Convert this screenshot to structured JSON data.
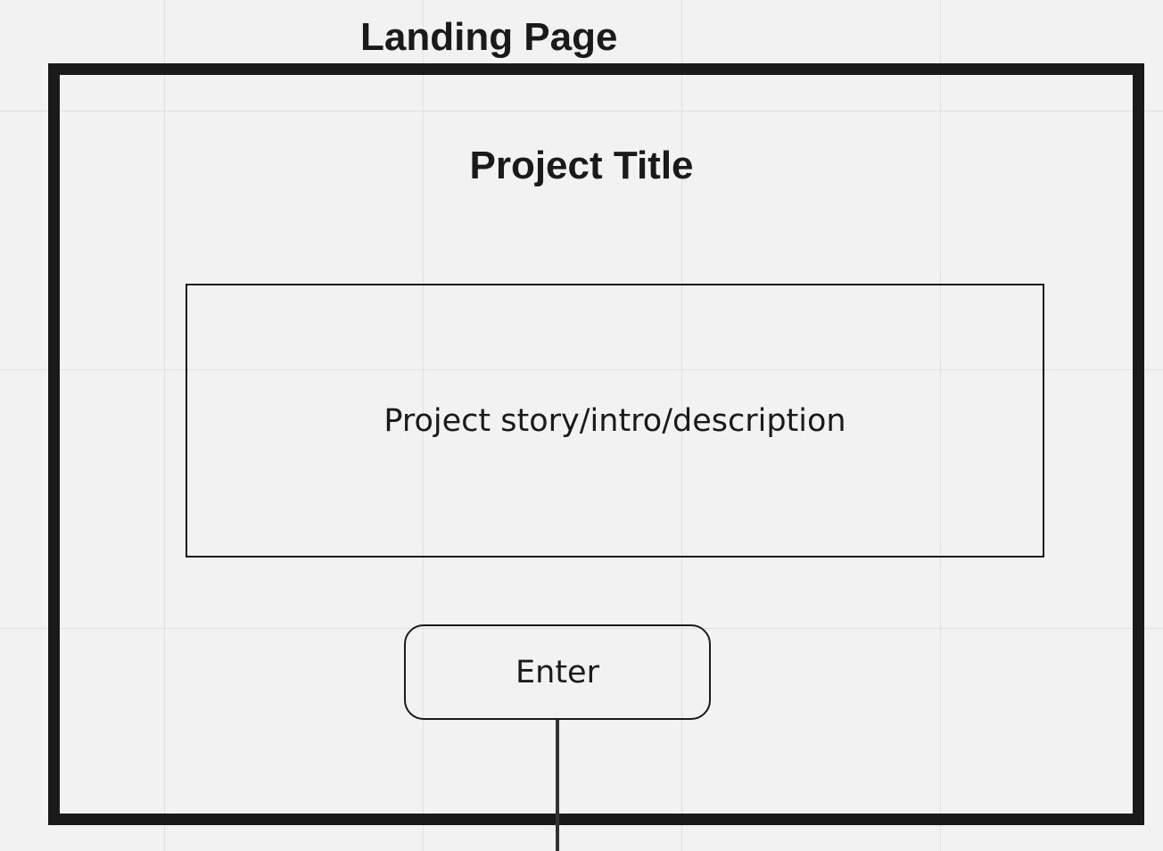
{
  "frame": {
    "label": "Landing Page"
  },
  "page": {
    "title": "Project Title",
    "description": "Project story/intro/description",
    "enter_label": "Enter"
  },
  "colors": {
    "canvas": "#f2f2f2",
    "grid": "#e1e1e1",
    "stroke": "#1a1a1a"
  }
}
